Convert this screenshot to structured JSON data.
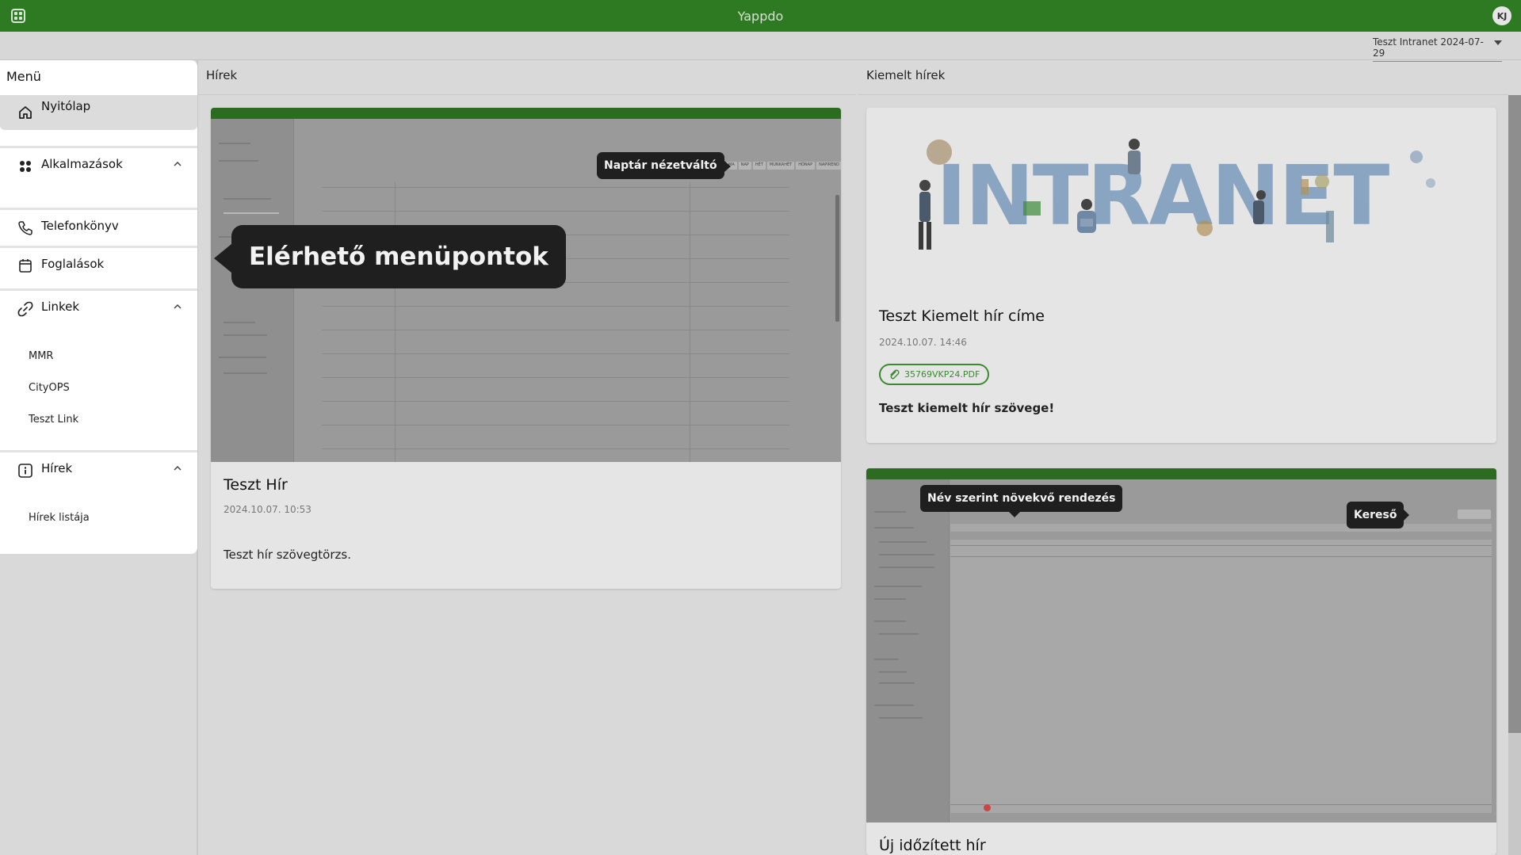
{
  "app": {
    "title": "Yappdo",
    "user_initials": "KJ"
  },
  "tenant": {
    "selected": "Teszt Intranet 2024-07-29"
  },
  "sidebar": {
    "title": "Menü",
    "items": [
      {
        "label": "Nyitólap",
        "icon": "home-icon"
      },
      {
        "label": "Alkalmazások",
        "icon": "apps-icon"
      },
      {
        "label": "Telefonkönyv",
        "icon": "phone-icon"
      },
      {
        "label": "Foglalások",
        "icon": "calendar-icon"
      },
      {
        "label": "Linkek",
        "icon": "link-icon",
        "children": [
          "MMR",
          "CityOPS",
          "Teszt Link"
        ]
      },
      {
        "label": "Hírek",
        "icon": "info-icon",
        "children": [
          "Hírek listája"
        ]
      }
    ]
  },
  "news": {
    "header": "Hírek",
    "card": {
      "title": "Teszt Hír",
      "date": "2024.10.07. 10:53",
      "body": "Teszt hír szövegtörzs."
    },
    "tooltips": {
      "menu": "Elérhető menüpontok",
      "view_switch": "Naptár nézetváltó"
    },
    "shot_buttons": [
      "MA",
      "NAP",
      "HÉT",
      "MUNKAHÉT",
      "HÓNAP",
      "NAPIREND"
    ]
  },
  "featured": {
    "header": "Kiemelt hírek",
    "banner_word": "INTRANET",
    "card": {
      "title": "Teszt Kiemelt hír címe",
      "date": "2024.10.07. 14:46",
      "attachment": "35769VKP24.PDF",
      "body": "Teszt kiemelt hír szövege!"
    },
    "second": {
      "title": "Új időzített hír"
    },
    "tooltips": {
      "sort": "Név szerint növekvő rendezés",
      "search": "Kereső"
    }
  },
  "colors": {
    "brand": "#2d7a22",
    "accent": "#3b8a2f",
    "overlay_gray": "#d9d9d9"
  }
}
